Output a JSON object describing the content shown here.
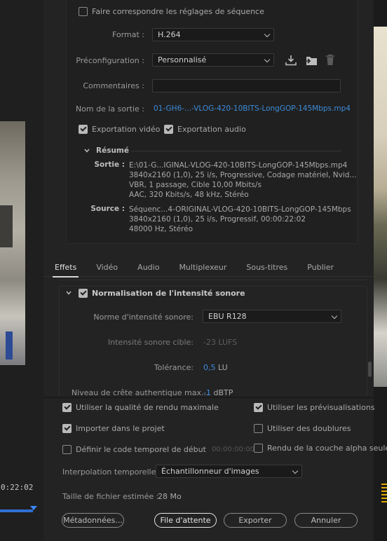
{
  "sequence_match": {
    "label": "Faire correspondre les réglages de séquence",
    "checked": false
  },
  "format": {
    "label": "Format :",
    "value": "H.264"
  },
  "preset": {
    "label": "Préconfiguration :",
    "value": "Personnalisé"
  },
  "comments": {
    "label": "Commentaires :",
    "value": ""
  },
  "output_name": {
    "label": "Nom de la sortie :",
    "value": "01-GH6-...-VLOG-420-10BITS-LongGOP-145Mbps.mp4"
  },
  "export_video": {
    "label": "Exportation vidéo",
    "checked": true
  },
  "export_audio": {
    "label": "Exportation audio",
    "checked": true
  },
  "summary": {
    "title": "Résumé",
    "output_key": "Sortie :",
    "output_lines": [
      "E:\\01-G...IGINAL-VLOG-420-10BITS-LongGOP-145Mbps.mp4",
      "3840x2160 (1,0), 25 i/s, Progressive, Codage matériel, Nvid...",
      "VBR, 1 passage, Cible 10,00  Mbits/s",
      "AAC, 320  Kbits/s, 48  kHz, Stéréo"
    ],
    "source_key": "Source :",
    "source_lines": [
      "Séquenc...4-ORIGINAL-VLOG-420-10BITS-LongGOP-145Mbps",
      "3840x2160 (1,0), 25  i/s, Progressif, 00:00:22:02",
      "48000 Hz, Stéréo"
    ]
  },
  "tabs": [
    "Effets",
    "Vidéo",
    "Audio",
    "Multiplexeur",
    "Sous-titres",
    "Publier"
  ],
  "effects": {
    "section_title": "Normalisation de l'intensité sonore",
    "section_checked": true,
    "loudness_standard": {
      "label": "Norme d'intensité sonore:",
      "value": "EBU R128"
    },
    "target_loudness": {
      "label": "Intensité sonore cible:",
      "value": "-23",
      "unit": "LUFS"
    },
    "tolerance": {
      "label": "Tolérance:",
      "value": "0,5",
      "unit": "LU"
    },
    "true_peak": {
      "label": "Niveau de crête authentique max...",
      "value": "-1",
      "unit": "dBTP"
    }
  },
  "bottom": {
    "max_render_quality": {
      "label": "Utiliser la qualité de rendu maximale",
      "checked": true
    },
    "use_previews": {
      "label": "Utiliser les prévisualisations",
      "checked": true
    },
    "import_project": {
      "label": "Importer dans le projet",
      "checked": true
    },
    "use_proxies": {
      "label": "Utiliser des doublures",
      "checked": false
    },
    "set_timecode": {
      "label": "Définir le code temporel de début",
      "checked": false,
      "value": "00:00:00:00"
    },
    "render_alpha": {
      "label": "Rendu de la couche alpha seule",
      "checked": false
    },
    "time_interpolation": {
      "label": "Interpolation temporelle :",
      "value": "Échantillonneur d'images"
    },
    "file_size": {
      "label": "Taille de fichier estimée :",
      "value": "28 Mo"
    },
    "buttons": {
      "metadata": "Métadonnées...",
      "queue": "File d'attente",
      "export": "Exporter",
      "cancel": "Annuler"
    }
  },
  "timecode": "0:22:02",
  "colors": {
    "accent_link": "#3d8bd9",
    "timeline_blue": "#2f6fd3"
  }
}
